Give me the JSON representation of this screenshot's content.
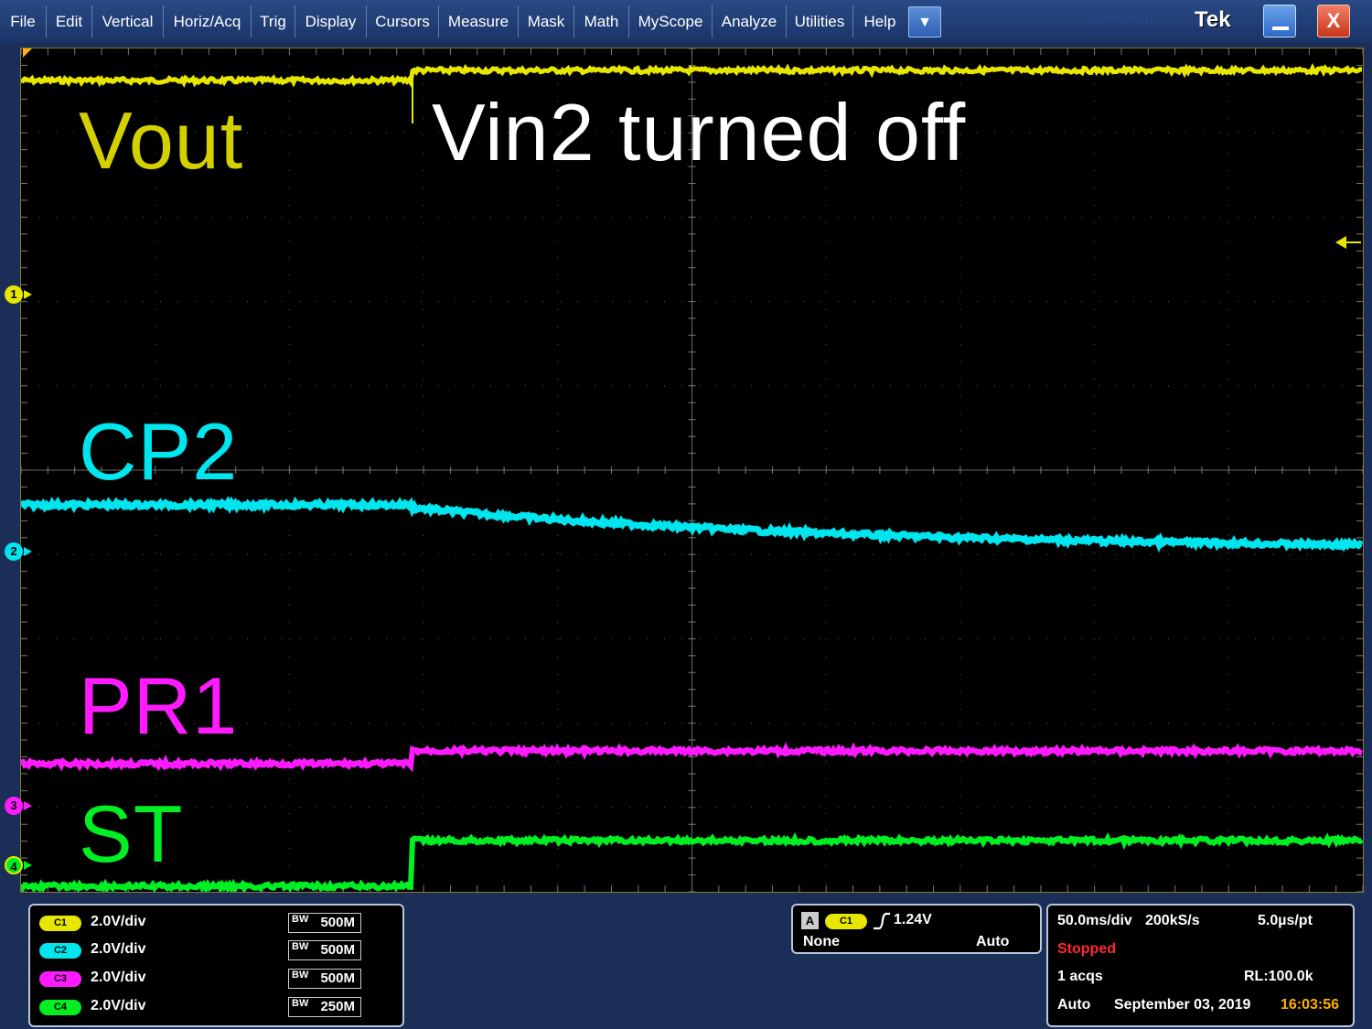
{
  "menubar": {
    "items": [
      "File",
      "Edit",
      "Vertical",
      "Horiz/Acq",
      "Trig",
      "Display",
      "Cursors",
      "Measure",
      "Mask",
      "Math",
      "MyScope",
      "Analyze",
      "Utilities",
      "Help"
    ],
    "dropdown_icon": "chevron-down-icon",
    "dropdown_glyph": "▼",
    "model": "DPO5054B",
    "logo": "Tek",
    "close_glyph": "X"
  },
  "overlay": {
    "vout": "Vout",
    "annotation": "Vin2 turned off",
    "cp2": "CP2",
    "pr1": "PR1",
    "st": "ST"
  },
  "markers": {
    "ch1": "1",
    "ch2": "2",
    "ch3": "3",
    "ch4": "4"
  },
  "colors": {
    "ch1": "#e6e600",
    "ch2": "#00e5ee",
    "ch3": "#ff1aff",
    "ch4": "#00ee22",
    "stopped": "#ff2a2a",
    "time": "#ffb000"
  },
  "channels": [
    {
      "pill": "C1",
      "scale": "2.0V/div",
      "bw": "500M"
    },
    {
      "pill": "C2",
      "scale": "2.0V/div",
      "bw": "500M"
    },
    {
      "pill": "C3",
      "scale": "2.0V/div",
      "bw": "500M"
    },
    {
      "pill": "C4",
      "scale": "2.0V/div",
      "bw": "250M"
    }
  ],
  "bw_prefix": "BW",
  "trigger": {
    "mode_badge": "A",
    "source": "C1",
    "slope_icon": "rising-edge-icon",
    "level": "1.24V",
    "coupling": "None",
    "sweep": "Auto"
  },
  "timebase": {
    "scale": "50.0ms/div",
    "sample_rate": "200kS/s",
    "per_point": "5.0µs/pt",
    "status": "Stopped",
    "acqs": "1 acqs",
    "record_length": "RL:100.0k",
    "mode": "Auto",
    "date": "September 03, 2019",
    "time": "16:03:56"
  }
}
